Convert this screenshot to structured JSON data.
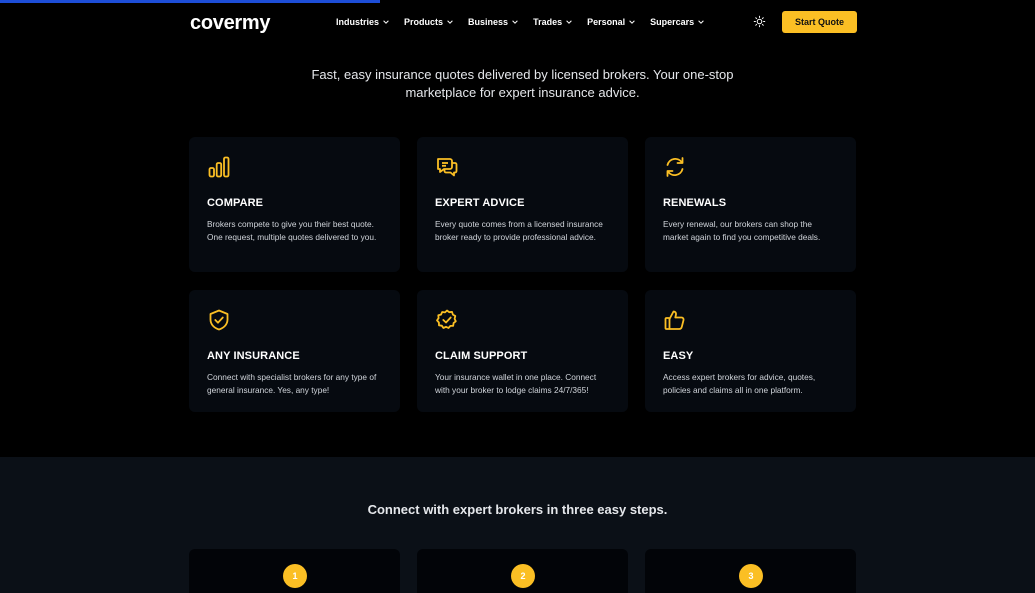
{
  "header": {
    "logo": "covermy",
    "nav": [
      {
        "label": "Industries"
      },
      {
        "label": "Products"
      },
      {
        "label": "Business"
      },
      {
        "label": "Trades"
      },
      {
        "label": "Personal"
      },
      {
        "label": "Supercars"
      }
    ],
    "cta_label": "Start Quote"
  },
  "intro": {
    "text": "Fast, easy insurance quotes delivered by licensed brokers. Your one-stop marketplace for expert insurance advice."
  },
  "features": [
    {
      "icon": "bar-chart-icon",
      "title": "COMPARE",
      "desc": "Brokers compete to give you their best quote. One request, multiple quotes delivered to you."
    },
    {
      "icon": "chat-bubbles-icon",
      "title": "EXPERT ADVICE",
      "desc": "Every quote comes from a licensed insurance broker ready to provide professional advice."
    },
    {
      "icon": "refresh-icon",
      "title": "RENEWALS",
      "desc": "Every renewal, our brokers can shop the market again to find you competitive deals."
    },
    {
      "icon": "shield-check-icon",
      "title": "ANY INSURANCE",
      "desc": "Connect with specialist brokers for any type of general insurance. Yes, any type!"
    },
    {
      "icon": "badge-check-icon",
      "title": "CLAIM SUPPORT",
      "desc": "Your insurance wallet in one place. Connect with your broker to lodge claims 24/7/365!"
    },
    {
      "icon": "thumbs-up-icon",
      "title": "EASY",
      "desc": "Access expert brokers for advice, quotes, policies and claims all in one platform."
    }
  ],
  "steps": {
    "title": "Connect with expert brokers in three easy steps.",
    "items": [
      {
        "number": "1"
      },
      {
        "number": "2"
      },
      {
        "number": "3"
      }
    ]
  },
  "colors": {
    "accent": "#fbbf24",
    "background": "#000000",
    "card": "#060a10",
    "progress": "#1d4ed8"
  }
}
